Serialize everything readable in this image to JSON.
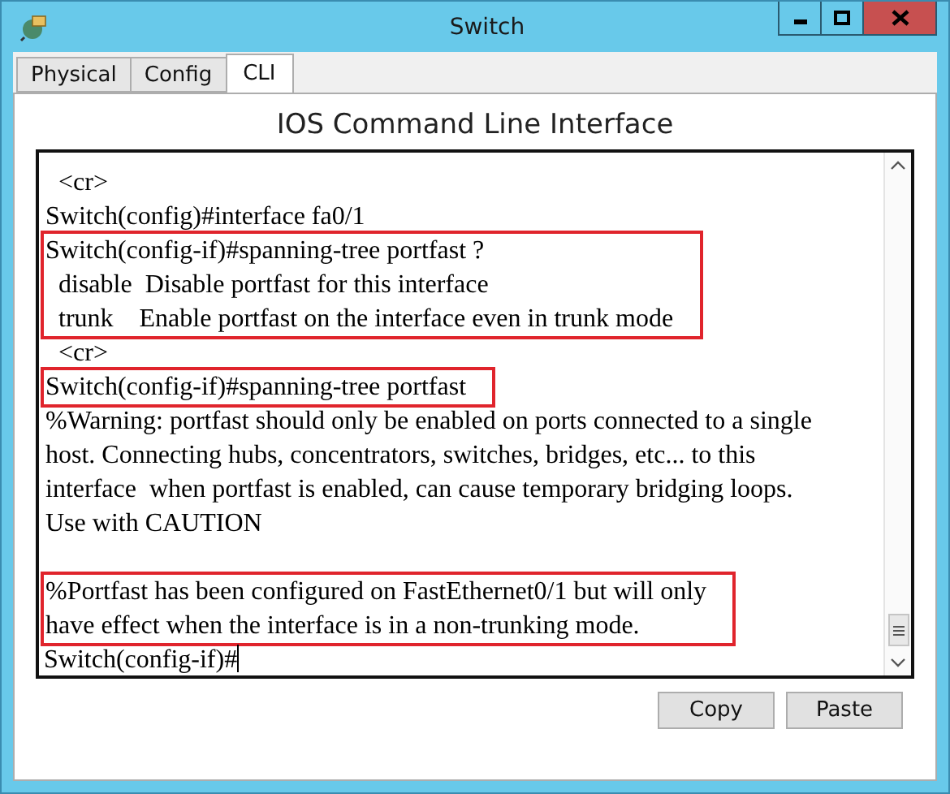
{
  "window": {
    "title": "Switch"
  },
  "tabs": [
    {
      "label": "Physical",
      "selected": false
    },
    {
      "label": "Config",
      "selected": false
    },
    {
      "label": "CLI",
      "selected": true
    }
  ],
  "heading": "IOS Command Line Interface",
  "terminal": {
    "blocks": [
      {
        "highlighted": false,
        "lines": [
          "  <cr>",
          "Switch(config)#interface fa0/1"
        ]
      },
      {
        "highlighted": true,
        "lines": [
          "Switch(config-if)#spanning-tree portfast ?",
          "  disable  Disable portfast for this interface",
          "  trunk    Enable portfast on the interface even in trunk mode"
        ]
      },
      {
        "highlighted": false,
        "lines": [
          "  <cr>"
        ]
      },
      {
        "highlighted": true,
        "lines": [
          "Switch(config-if)#spanning-tree portfast"
        ]
      },
      {
        "highlighted": false,
        "lines": [
          "%Warning: portfast should only be enabled on ports connected to a single",
          "host. Connecting hubs, concentrators, switches, bridges, etc... to this",
          "interface  when portfast is enabled, can cause temporary bridging loops.",
          "Use with CAUTION"
        ]
      },
      {
        "highlighted": true,
        "blank_line_before": true,
        "lines": [
          "%Portfast has been configured on FastEthernet0/1 but will only",
          "have effect when the interface is in a non-trunking mode."
        ]
      }
    ],
    "prompt": "Switch(config-if)#",
    "cursor": true
  },
  "buttons": [
    "Copy",
    "Paste"
  ]
}
